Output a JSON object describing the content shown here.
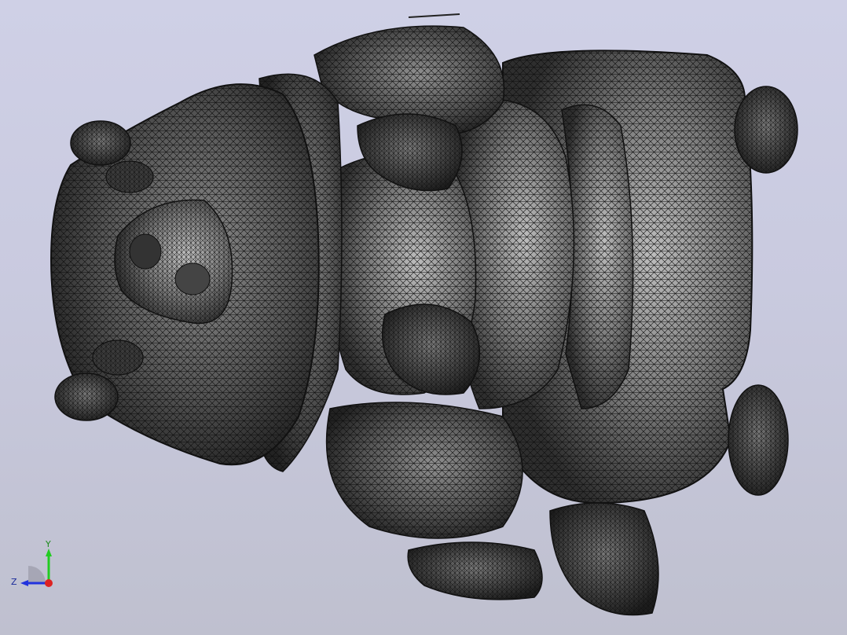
{
  "viewport": {
    "background_top": "#cfd0e6",
    "background_bottom": "#bfc0cf",
    "display_mode": "wireframe mesh",
    "model_fill": "#4a4a4a",
    "mesh_line_color": "#111111"
  },
  "triad": {
    "y_label": "Y",
    "z_label": "Z",
    "y_color": "#22cc22",
    "z_color": "#2233dd",
    "x_color": "#dd2222"
  }
}
